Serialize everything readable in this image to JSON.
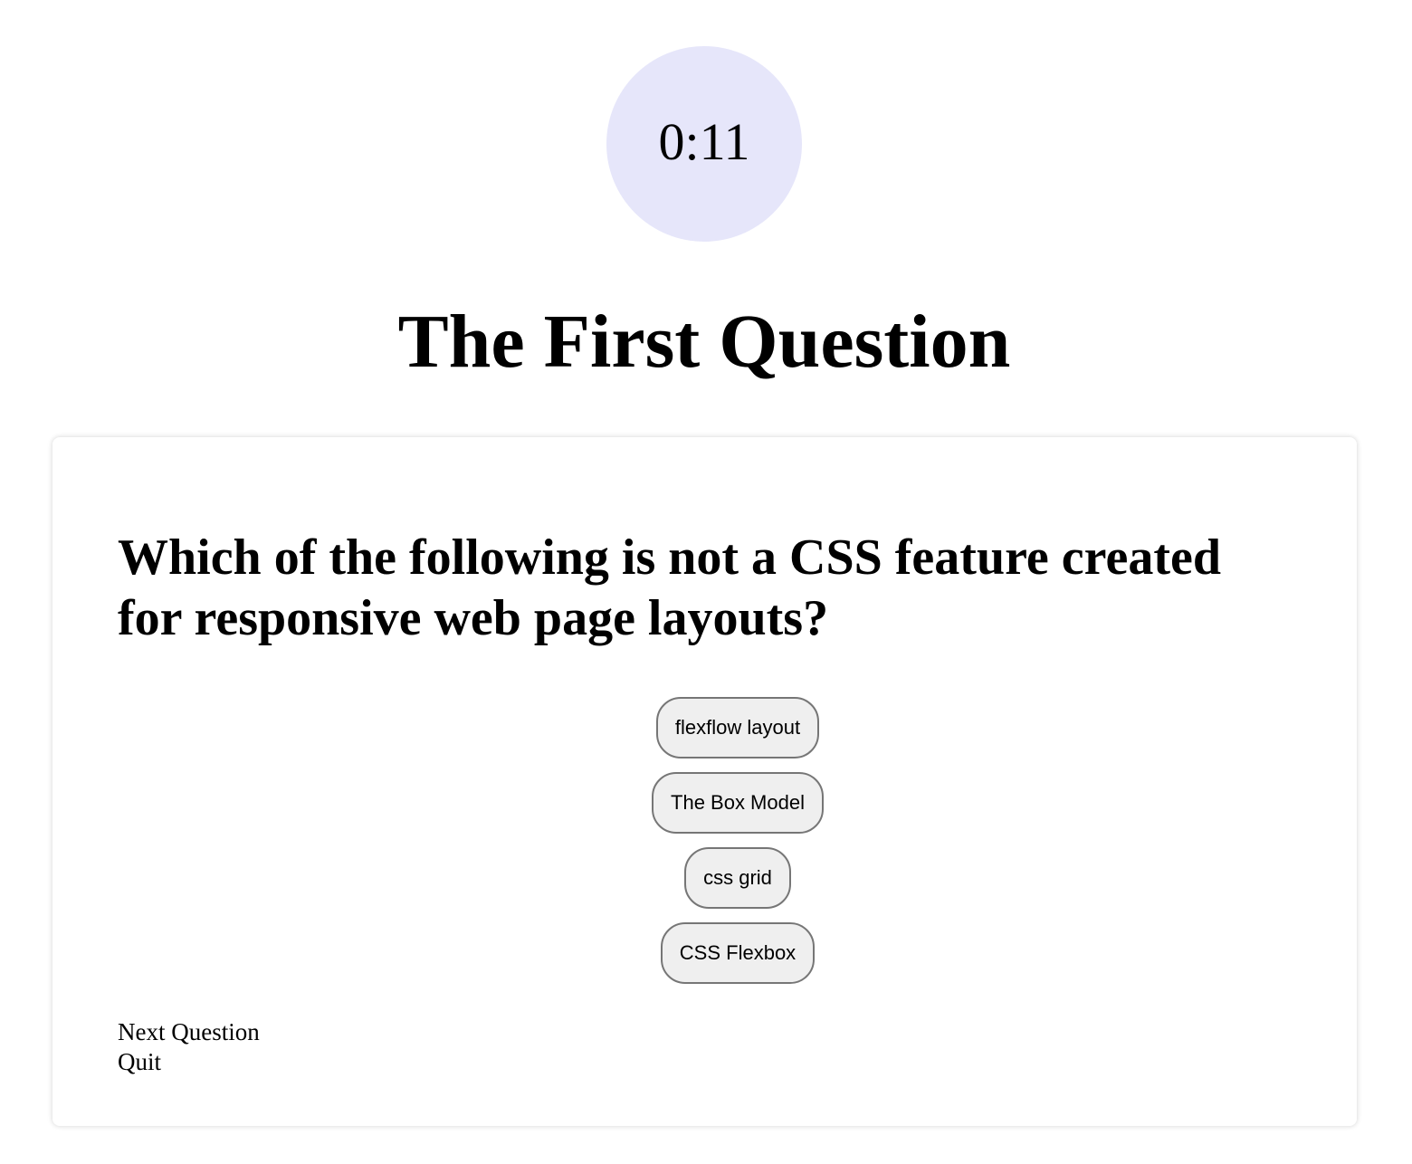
{
  "timer": {
    "value": "0:11",
    "color": "#e6e6fa"
  },
  "title": "The First Question",
  "question": {
    "text": "Which of the following is not a CSS feature created for responsive web page layouts?",
    "answers": [
      "flexflow layout",
      "The Box Model",
      "css grid",
      "CSS Flexbox"
    ]
  },
  "actions": {
    "next": "Next Question",
    "quit": "Quit"
  }
}
